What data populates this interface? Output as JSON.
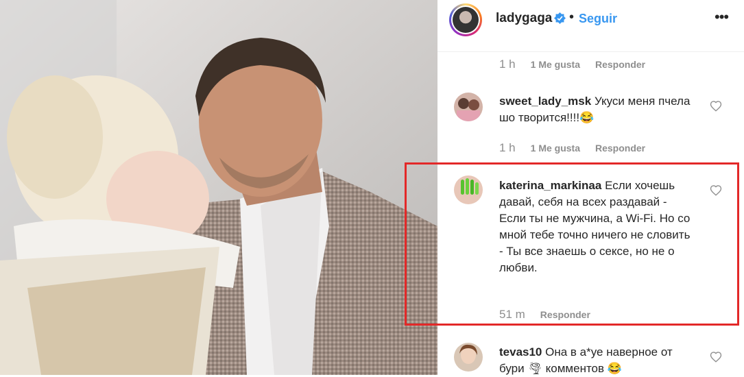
{
  "post": {
    "username": "ladygaga",
    "follow_label": "Seguir",
    "more_label": "•••"
  },
  "comments": [
    {
      "time": "1 h",
      "likes": "1 Me gusta",
      "reply": "Responder"
    },
    {
      "username": "sweet_lady_msk",
      "text": "Укуси меня пчела шо творится!!!!😂",
      "time": "1 h",
      "likes": "1 Me gusta",
      "reply": "Responder"
    },
    {
      "username": "katerina_markinaa",
      "text": "Если хочешь давай, себя на всех раздавай - Если ты не мужчина, а Wi-Fi. Но со мной тебе точно ничего не словить - Ты все знаешь о сексе, но не о любви.",
      "time": "51 m",
      "reply": "Responder"
    },
    {
      "username": "tevas10",
      "text": "Она в а*уе наверное от бури 🌪 комментов 😂"
    }
  ],
  "colors": {
    "link_blue": "#3897f0",
    "highlight_red": "#e32828",
    "meta_gray": "#8e8e8e"
  }
}
